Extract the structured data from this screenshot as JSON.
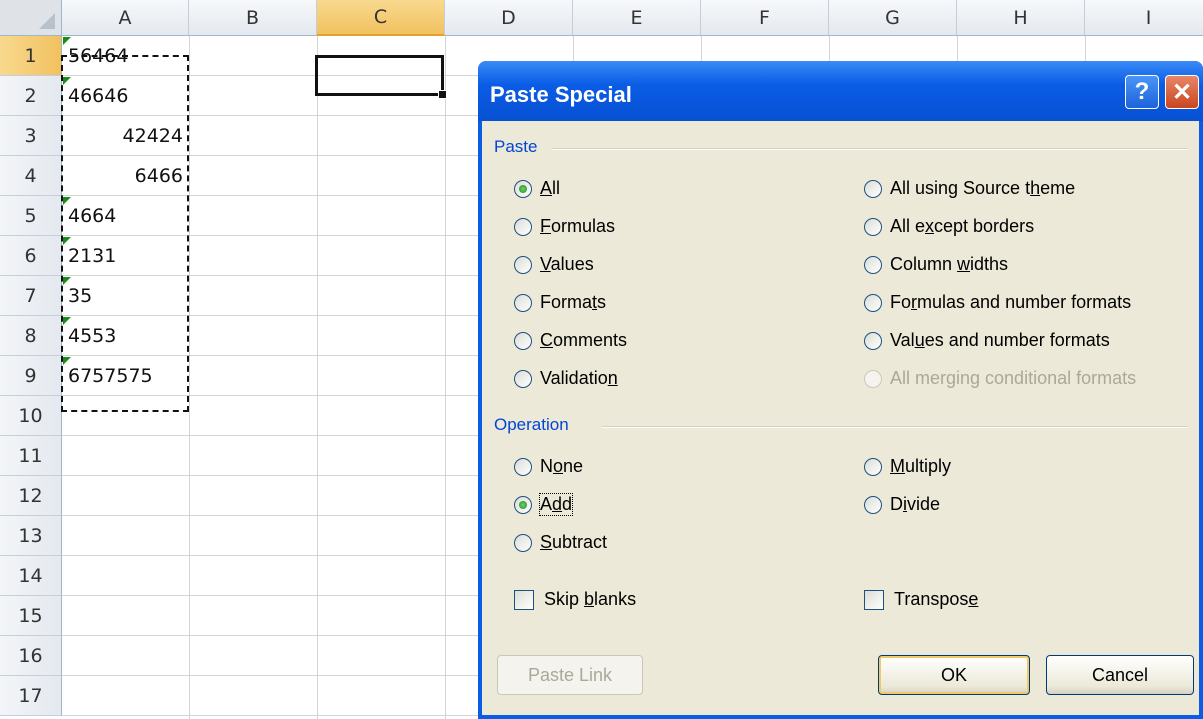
{
  "sheet": {
    "columns": [
      {
        "label": "A",
        "selected": false
      },
      {
        "label": "B",
        "selected": false
      },
      {
        "label": "C",
        "selected": true
      },
      {
        "label": "D",
        "selected": false
      },
      {
        "label": "E",
        "selected": false
      },
      {
        "label": "F",
        "selected": false
      },
      {
        "label": "G",
        "selected": false
      },
      {
        "label": "H",
        "selected": false
      },
      {
        "label": "I",
        "selected": false
      }
    ],
    "rows": [
      "1",
      "2",
      "3",
      "4",
      "5",
      "6",
      "7",
      "8",
      "9",
      "10",
      "11",
      "12",
      "13",
      "14",
      "15",
      "16",
      "17"
    ],
    "selected_row": "1",
    "column_a": [
      {
        "value": "56464",
        "align": "left",
        "text_format": true
      },
      {
        "value": "46646",
        "align": "left",
        "text_format": true
      },
      {
        "value": "42424",
        "align": "right",
        "text_format": false
      },
      {
        "value": "6466",
        "align": "right",
        "text_format": false
      },
      {
        "value": "4664",
        "align": "left",
        "text_format": true
      },
      {
        "value": "2131",
        "align": "left",
        "text_format": true
      },
      {
        "value": "35",
        "align": "left",
        "text_format": true
      },
      {
        "value": "4553",
        "align": "left",
        "text_format": true
      },
      {
        "value": "6757575",
        "align": "left",
        "text_format": true
      }
    ],
    "active_cell": "C1"
  },
  "dialog": {
    "title": "Paste Special",
    "help_glyph": "?",
    "close_glyph": "✕",
    "paste_group": {
      "title": "Paste",
      "left": [
        {
          "pre": "",
          "key": "A",
          "post": "ll",
          "checked": true
        },
        {
          "pre": "",
          "key": "F",
          "post": "ormulas",
          "checked": false
        },
        {
          "pre": "",
          "key": "V",
          "post": "alues",
          "checked": false
        },
        {
          "pre": "Forma",
          "key": "t",
          "post": "s",
          "checked": false
        },
        {
          "pre": "",
          "key": "C",
          "post": "omments",
          "checked": false
        },
        {
          "pre": "Validatio",
          "key": "n",
          "post": "",
          "checked": false
        }
      ],
      "right": [
        {
          "pre": "All using Source t",
          "key": "h",
          "post": "eme",
          "checked": false,
          "disabled": false
        },
        {
          "pre": "All e",
          "key": "x",
          "post": "cept borders",
          "checked": false,
          "disabled": false
        },
        {
          "pre": "Column ",
          "key": "w",
          "post": "idths",
          "checked": false,
          "disabled": false
        },
        {
          "pre": "Fo",
          "key": "r",
          "post": "mulas and number formats",
          "checked": false,
          "disabled": false
        },
        {
          "pre": "Val",
          "key": "u",
          "post": "es and number formats",
          "checked": false,
          "disabled": false
        },
        {
          "pre": "All merging conditional formats",
          "key": "",
          "post": "",
          "checked": false,
          "disabled": true
        }
      ]
    },
    "operation_group": {
      "title": "Operation",
      "left": [
        {
          "pre": "N",
          "key": "o",
          "post": "ne",
          "checked": false
        },
        {
          "pre": "A",
          "key": "d",
          "post": "d",
          "checked": true
        },
        {
          "pre": "",
          "key": "S",
          "post": "ubtract",
          "checked": false
        }
      ],
      "right": [
        {
          "pre": "",
          "key": "M",
          "post": "ultiply",
          "checked": false
        },
        {
          "pre": "D",
          "key": "i",
          "post": "vide",
          "checked": false
        }
      ]
    },
    "skip_blanks": {
      "pre": "Skip ",
      "key": "b",
      "post": "lanks",
      "checked": false
    },
    "transpose": {
      "pre": "Transpos",
      "key": "e",
      "post": "",
      "checked": false
    },
    "buttons": {
      "paste_link": "Paste Link",
      "ok": "OK",
      "cancel": "Cancel"
    }
  }
}
